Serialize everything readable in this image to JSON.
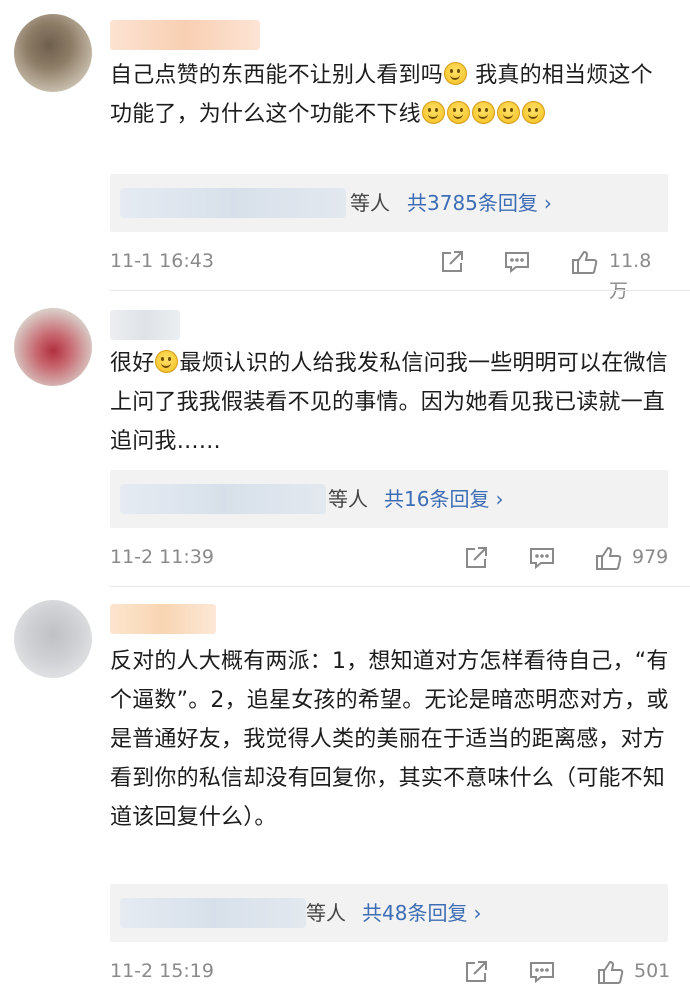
{
  "comments": [
    {
      "text_parts": [
        "自己点赞的东西能不让别人看到吗",
        " 我真的相当烦这个功能了，为什么这个功能不下线"
      ],
      "reply_suffix": "等人",
      "reply_count_label": "共3785条回复",
      "timestamp": "11-1 16:43",
      "likes": "11.8万"
    },
    {
      "text_parts": [
        "很好",
        "最烦认识的人给我发私信问我一些明明可以在微信上问了我我假装看不见的事情。因为她看见我已读就一直追问我……"
      ],
      "reply_suffix": "等人",
      "reply_count_label": "共16条回复",
      "timestamp": "11-2 11:39",
      "likes": "979"
    },
    {
      "text": "反对的人大概有两派：1，想知道对方怎样看待自己，“有个逼数”。2，追星女孩的希望。无论是暗恋明恋对方，或是普通好友，我觉得人类的美丽在于适当的距离感，对方看到你的私信却没有回复你，其实不意味什么（可能不知道该回复什么）。",
      "reply_suffix": "等人",
      "reply_count_label": "共48条回复",
      "timestamp": "11-2 15:19",
      "likes": "501"
    }
  ],
  "icons": {
    "share": "share-icon",
    "comment": "comment-icon",
    "like": "thumbs-up-icon",
    "emoji": "smiley-emoji-icon",
    "reply_chevron": "chevron-right-icon"
  },
  "colors": {
    "link": "#3d6db5",
    "meta": "#8a8a8a",
    "reply_bg": "#f2f2f2"
  }
}
